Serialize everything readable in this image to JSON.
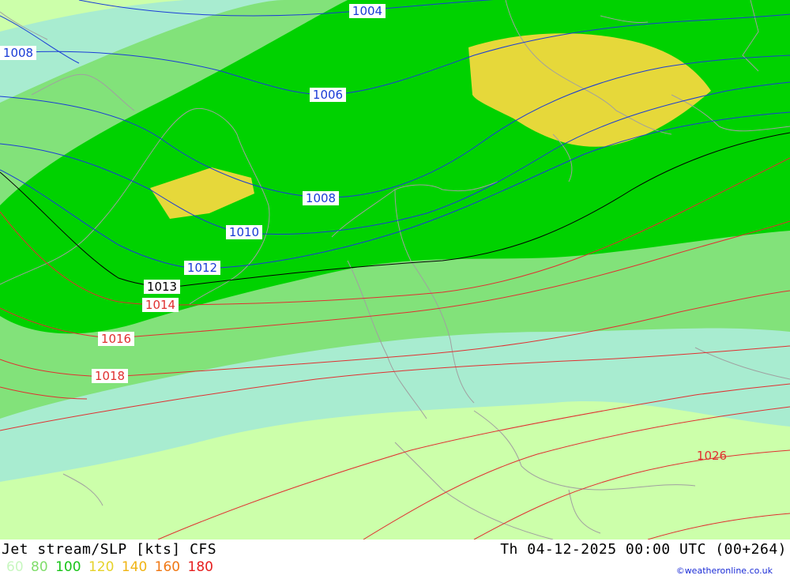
{
  "title": "Jet stream/SLP [kts] CFS",
  "datetime": "Th 04-12-2025 00:00 UTC (00+264)",
  "credit": "©weatheronline.co.uk",
  "legend": [
    {
      "label": "60",
      "color": "#c8f7c0"
    },
    {
      "label": "80",
      "color": "#7fdd6a"
    },
    {
      "label": "100",
      "color": "#19c419"
    },
    {
      "label": "120",
      "color": "#e6d22a"
    },
    {
      "label": "140",
      "color": "#f0b414"
    },
    {
      "label": "160",
      "color": "#f07814"
    },
    {
      "label": "180",
      "color": "#e61e1e"
    }
  ],
  "isobars": [
    {
      "label": "1004",
      "color": "#1a3cd6"
    },
    {
      "label": "1006",
      "color": "#1a3cd6"
    },
    {
      "label": "1008",
      "color": "#1a3cd6"
    },
    {
      "label": "1008",
      "color": "#1a3cd6"
    },
    {
      "label": "1010",
      "color": "#1a3cd6"
    },
    {
      "label": "1012",
      "color": "#1a3cd6"
    },
    {
      "label": "1013",
      "color": "#000000"
    },
    {
      "label": "1014",
      "color": "#e03030"
    },
    {
      "label": "1016",
      "color": "#e03030"
    },
    {
      "label": "1018",
      "color": "#e03030"
    },
    {
      "label": "1026",
      "color": "#e03030"
    }
  ],
  "colors": {
    "speed_60": "#ccffaa",
    "speed_80_band": "#a8ecd0",
    "speed_light_green": "#82e27a",
    "speed_100": "#00d200",
    "speed_120": "#e6d83a",
    "land_outline": "#a0a0a0"
  }
}
